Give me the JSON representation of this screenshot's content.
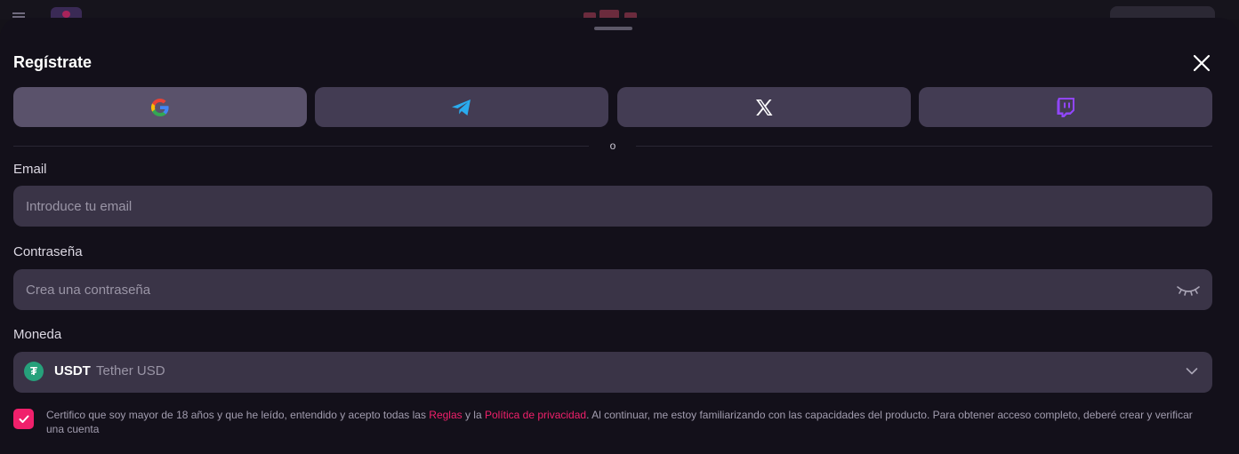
{
  "title": "Regístrate",
  "social_buttons": [
    {
      "name": "google",
      "icon": "google-icon"
    },
    {
      "name": "telegram",
      "icon": "telegram-icon"
    },
    {
      "name": "x",
      "icon": "x-icon"
    },
    {
      "name": "twitch",
      "icon": "twitch-icon"
    }
  ],
  "divider_text": "o",
  "email": {
    "label": "Email",
    "placeholder": "Introduce tu email",
    "value": ""
  },
  "password": {
    "label": "Contraseña",
    "placeholder": "Crea una contraseña",
    "value": ""
  },
  "currency": {
    "label": "Moneda",
    "code": "USDT",
    "name": "Tether USD",
    "icon_glyph": "₮"
  },
  "terms": {
    "checked": true,
    "text_before": "Certifico que soy mayor de 18 años y que he leído, entendido y acepto todas las ",
    "rules_link": "Reglas",
    "text_middle": " y la ",
    "privacy_link": "Política de privacidad",
    "text_after": ". Al continuar, me estoy familiarizando con las capacidades del producto. Para obtener acceso completo, deberé crear y verificar una cuenta"
  },
  "colors": {
    "accent": "#f0206b",
    "sheet_bg": "#13101a",
    "input_bg": "#3a3447",
    "social_bg": "#433c53",
    "tether": "#26a17b",
    "telegram": "#2aabee",
    "twitch": "#9146ff"
  }
}
